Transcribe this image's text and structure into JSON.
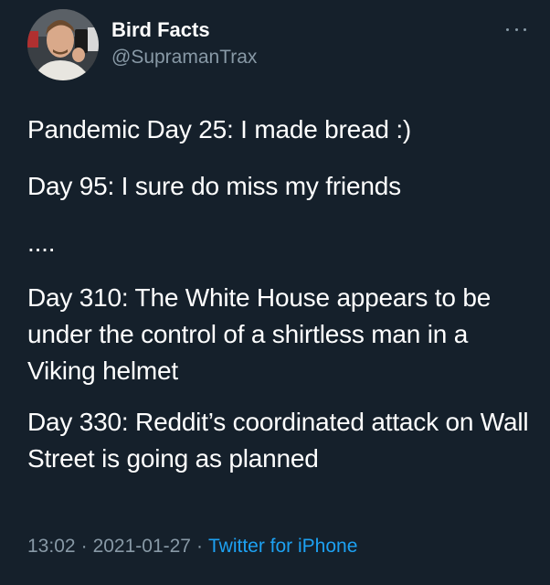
{
  "author": {
    "name": "Bird Facts",
    "handle": "@SupramanTrax"
  },
  "tweet": {
    "paragraphs": [
      "Pandemic Day 25: I made bread :)",
      "Day 95: I sure do miss my friends",
      "....",
      "Day 310: The White House appears to be under the control of a shirtless man in a Viking helmet",
      "Day 330: Reddit’s coordinated attack on Wall Street is going as planned"
    ],
    "time": "13:02",
    "date": "2021-01-27",
    "separator": "·",
    "source": "Twitter for iPhone"
  },
  "icons": {
    "more": "more-options-icon"
  },
  "colors": {
    "background": "#15202b",
    "text": "#ffffff",
    "muted": "#8899a6",
    "link": "#1da1f2"
  }
}
